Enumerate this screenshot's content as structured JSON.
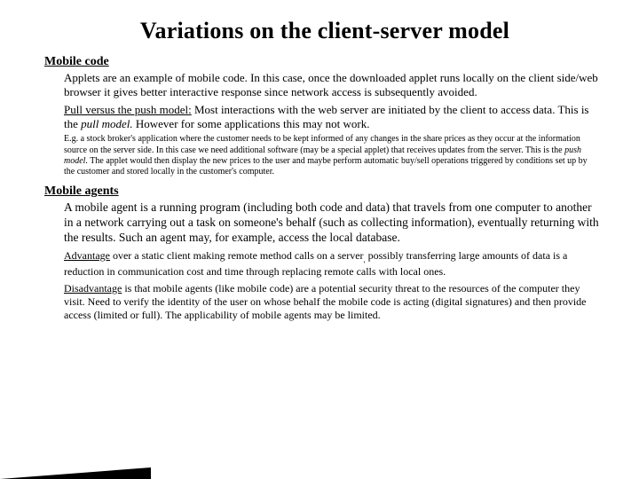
{
  "title": "Variations on the client-server model",
  "mobile_code_heading": "Mobile code",
  "mobile_code_p1_a": "Applets are an example of mobile code. In this case, once the downloaded applet runs locally on the client side/web browser it gives better interactive response since network access is subsequently avoided.",
  "mobile_code_p2_lead": "Pull versus the push model:",
  "mobile_code_p2_a": " Most interactions with the web server are initiated by the client to access data. This is the ",
  "mobile_code_p2_i": "pull model.",
  "mobile_code_p2_b": " However for some applications this may not work.",
  "mobile_code_small_a": "E.g. a stock broker's application where the customer needs to be kept informed of any changes in the share prices as they occur at the information source on the server side. In this case we need additional software (may be a special applet) that receives updates from the server. This is the ",
  "mobile_code_small_i": "push model.",
  "mobile_code_small_b": " The applet would then display the new prices to the user and maybe perform automatic buy/sell operations triggered by conditions set up by the customer and stored locally in the customer's computer.",
  "mobile_agents_heading": "Mobile agents",
  "mobile_agents_p1": "A mobile agent is a running program (including both code and data) that travels from one computer to another in a network carrying out a task on someone's behalf (such as collecting information), eventually returning with the results. Such an agent may, for example, access the local database.",
  "adv_u": "Advantage",
  "adv_a": " over a static client making remote method calls on a server",
  "adv_sub": ",",
  "adv_b": " possibly transferring large amounts of data is a reduction in communication cost and time through replacing remote calls with local ones.",
  "dis_u": "Disadvantage",
  "dis_a": " is that mobile agents (like mobile code) are a potential security threat to the resources of the computer they visit. Need to verify the identity of the user on whose behalf the mobile code is acting (digital signatures) and then provide access (limited or full).  The applicability of mobile agents may be limited."
}
